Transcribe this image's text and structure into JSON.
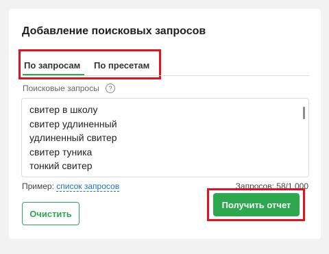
{
  "panel": {
    "title": "Добавление поисковых запросов",
    "tabs": [
      {
        "label": "По запросам",
        "active": true
      },
      {
        "label": "По пресетам",
        "active": false
      }
    ],
    "field_label": "Поисковые запросы",
    "help_icon": "?",
    "queries": [
      "свитер в школу",
      "свитер удлиненный",
      "удлиненный свитер",
      "свитер туника",
      "тонкий свитер"
    ],
    "example_prefix": "Пример:",
    "example_link": "список запросов",
    "counter": "Запросов: 58/1 000",
    "clear_button": "Очистить",
    "report_button": "Получить отчет"
  },
  "colors": {
    "accent": "#2ea84f",
    "highlight": "#e3101f",
    "link": "#1a73b7"
  }
}
